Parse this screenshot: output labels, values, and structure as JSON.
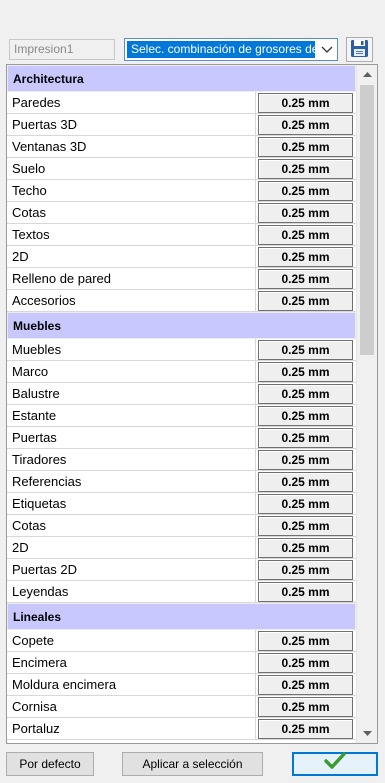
{
  "toolbar": {
    "name_value": "Impresion1",
    "combo_selected": "Selec. combinación de grosores de",
    "save_icon": "floppy-disk-icon"
  },
  "sections": [
    {
      "title": "Architectura",
      "rows": [
        {
          "label": "Paredes",
          "value": "0.25 mm"
        },
        {
          "label": "Puertas 3D",
          "value": "0.25 mm"
        },
        {
          "label": "Ventanas 3D",
          "value": "0.25 mm"
        },
        {
          "label": "Suelo",
          "value": "0.25 mm"
        },
        {
          "label": "Techo",
          "value": "0.25 mm"
        },
        {
          "label": "Cotas",
          "value": "0.25 mm"
        },
        {
          "label": "Textos",
          "value": "0.25 mm"
        },
        {
          "label": "2D",
          "value": "0.25 mm"
        },
        {
          "label": "Relleno de pared",
          "value": "0.25 mm"
        },
        {
          "label": "Accesorios",
          "value": "0.25 mm"
        }
      ]
    },
    {
      "title": "Muebles",
      "rows": [
        {
          "label": "Muebles",
          "value": "0.25 mm"
        },
        {
          "label": "Marco",
          "value": "0.25 mm"
        },
        {
          "label": "Balustre",
          "value": "0.25 mm"
        },
        {
          "label": "Estante",
          "value": "0.25 mm"
        },
        {
          "label": "Puertas",
          "value": "0.25 mm"
        },
        {
          "label": "Tiradores",
          "value": "0.25 mm"
        },
        {
          "label": "Referencias",
          "value": "0.25 mm"
        },
        {
          "label": "Etiquetas",
          "value": "0.25 mm"
        },
        {
          "label": "Cotas",
          "value": "0.25 mm"
        },
        {
          "label": "2D",
          "value": "0.25 mm"
        },
        {
          "label": "Puertas 2D",
          "value": "0.25 mm"
        },
        {
          "label": "Leyendas",
          "value": "0.25 mm"
        }
      ]
    },
    {
      "title": "Lineales",
      "rows": [
        {
          "label": "Copete",
          "value": "0.25 mm"
        },
        {
          "label": "Encimera",
          "value": "0.25 mm"
        },
        {
          "label": "Moldura encimera",
          "value": "0.25 mm"
        },
        {
          "label": "Cornisa",
          "value": "0.25 mm"
        },
        {
          "label": "Portaluz",
          "value": "0.25 mm"
        }
      ]
    }
  ],
  "scrollbar": {
    "position": 0.0,
    "visible_fraction": 0.42
  },
  "buttons": {
    "default_label": "Por defecto",
    "apply_label": "Aplicar a selección",
    "ok_icon": "checkmark-icon"
  },
  "colors": {
    "section_header": "#c8c8ff",
    "selection": "#0078d7",
    "ok_check": "#3c9b2e"
  }
}
